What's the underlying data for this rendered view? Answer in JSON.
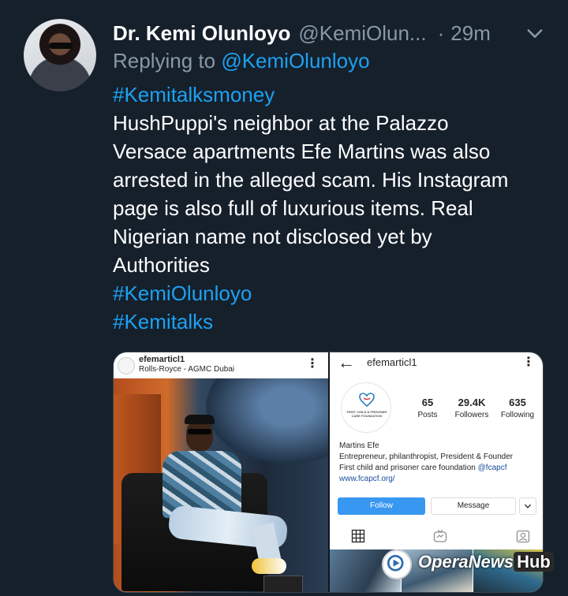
{
  "tweet": {
    "display_name": "Dr. Kemi Olunloyo",
    "handle": "@KemiOlun...",
    "dot": "·",
    "time": "29m",
    "replying_prefix": "Replying to",
    "replying_to": "@KemiOlunloyo",
    "hashtag_top": "#Kemitalksmoney",
    "body_lines": [
      "HushPuppi's neighbor at the Palazzo",
      "Versace apartments Efe Martins was also",
      "arrested in the alleged scam. His Instagram",
      "page is also full of luxurious items. Real",
      "Nigerian name not disclosed yet by",
      "Authorities"
    ],
    "hashtag_1": "#KemiOlunloyo",
    "hashtag_2": "#Kemitalks",
    "icons": {
      "menu": "chevron-down-icon"
    }
  },
  "post": {
    "username": "efemarticl1",
    "location": "Rolls-Royce - AGMC Dubai",
    "more": "⋮"
  },
  "profile": {
    "username": "efemarticl1",
    "back": "←",
    "more": "⋮",
    "logo_text": "FIRST CHILD & PRISONER CARE FOUNDATION",
    "stats": [
      {
        "value": "65",
        "label": "Posts"
      },
      {
        "value": "29.4K",
        "label": "Followers"
      },
      {
        "value": "635",
        "label": "Following"
      }
    ],
    "bio_name": "Martins Efe",
    "bio_line1": "Entrepreneur, philanthropist, President & Founder",
    "bio_line2_text": "First child and prisoner care foundation ",
    "bio_line2_mention": "@fcapcf",
    "bio_url": "www.fcapcf.org/",
    "follow_label": "Follow",
    "message_label": "Message"
  },
  "watermark": {
    "text": "OperaNews",
    "hub": "Hub"
  },
  "colors": {
    "background": "#15202b",
    "accent": "#1da1f2",
    "muted": "#8899a6",
    "follow_button": "#3897f0"
  }
}
